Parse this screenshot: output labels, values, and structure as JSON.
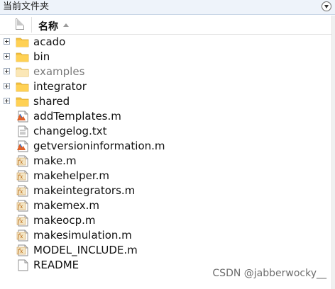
{
  "panel": {
    "title": "当前文件夹"
  },
  "columns": {
    "name": "名称"
  },
  "items": [
    {
      "label": "acado",
      "type": "folder"
    },
    {
      "label": "bin",
      "type": "folder"
    },
    {
      "label": "examples",
      "type": "folder",
      "dimmed": true
    },
    {
      "label": "integrator",
      "type": "folder"
    },
    {
      "label": "shared",
      "type": "folder"
    },
    {
      "label": "addTemplates.m",
      "type": "m-script-file"
    },
    {
      "label": "changelog.txt",
      "type": "text-file"
    },
    {
      "label": "getversioninformation.m",
      "type": "m-script-file"
    },
    {
      "label": "make.m",
      "type": "m-function-file"
    },
    {
      "label": "makehelper.m",
      "type": "m-function-file"
    },
    {
      "label": "makeintegrators.m",
      "type": "m-function-file"
    },
    {
      "label": "makemex.m",
      "type": "m-function-file"
    },
    {
      "label": "makeocp.m",
      "type": "m-function-file"
    },
    {
      "label": "makesimulation.m",
      "type": "m-function-file"
    },
    {
      "label": "MODEL_INCLUDE.m",
      "type": "m-function-file"
    },
    {
      "label": "README",
      "type": "blank-file"
    }
  ],
  "watermark": "CSDN @jabberwocky__",
  "colors": {
    "folder": "#f5c342",
    "folder_dim": "#f7dfa0",
    "header_bg": "#eef3fa"
  }
}
